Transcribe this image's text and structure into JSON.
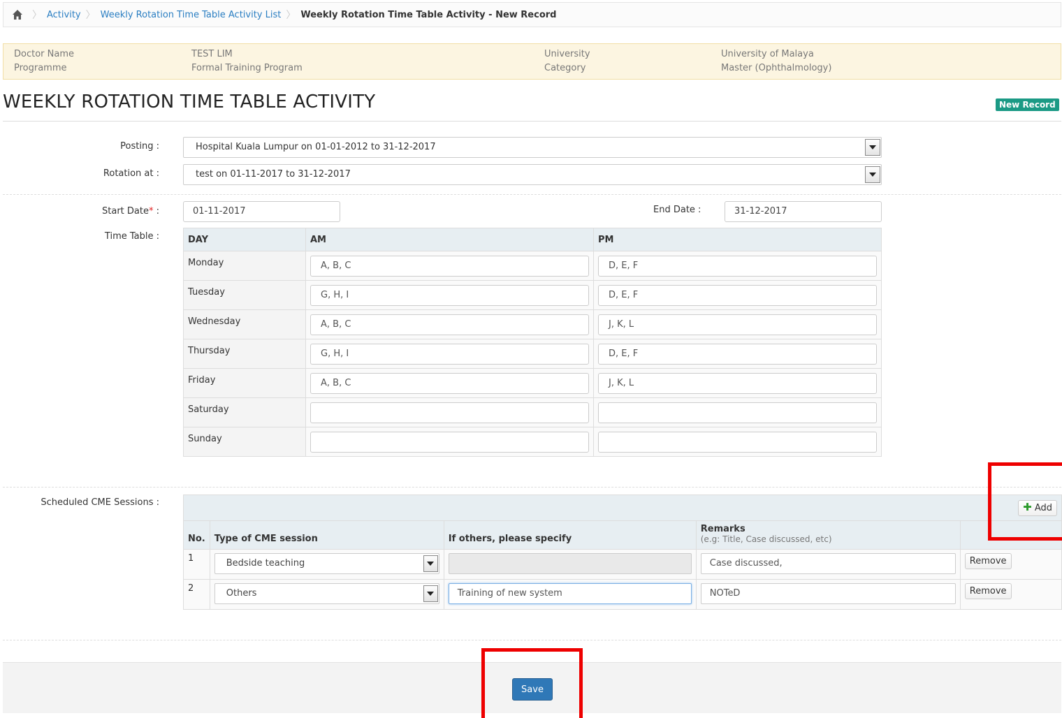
{
  "breadcrumb": {
    "items": [
      "Activity",
      "Weekly Rotation Time Table Activity List"
    ],
    "current": "Weekly Rotation Time Table Activity - New Record"
  },
  "info": {
    "doctor_name_label": "Doctor Name",
    "doctor_name": "TEST LIM",
    "programme_label": "Programme",
    "programme": "Formal Training Program",
    "university_label": "University",
    "university": "University of Malaya",
    "category_label": "Category",
    "category": "Master (Ophthalmology)"
  },
  "page": {
    "title": "WEEKLY ROTATION TIME TABLE ACTIVITY",
    "badge": "New Record"
  },
  "form": {
    "posting_label": "Posting :",
    "posting_value": "Hospital Kuala Lumpur on 01-01-2012 to 31-12-2017",
    "rotation_label": "Rotation at :",
    "rotation_value": "test on 01-11-2017 to 31-12-2017",
    "start_date_label": "Start Date",
    "start_date_required": "*",
    "start_date_colon": " :",
    "start_date": "01-11-2017",
    "end_date_label": "End Date :",
    "end_date": "31-12-2017",
    "timetable_label": "Time Table :"
  },
  "timetable": {
    "headers": [
      "DAY",
      "AM",
      "PM"
    ],
    "rows": [
      {
        "day": "Monday",
        "am": "A, B, C",
        "pm": "D, E, F"
      },
      {
        "day": "Tuesday",
        "am": "G, H, I",
        "pm": "D, E, F"
      },
      {
        "day": "Wednesday",
        "am": "A, B, C",
        "pm": "J, K, L"
      },
      {
        "day": "Thursday",
        "am": "G, H, I",
        "pm": "D, E, F"
      },
      {
        "day": "Friday",
        "am": "A, B, C",
        "pm": "J, K, L"
      },
      {
        "day": "Saturday",
        "am": "",
        "pm": ""
      },
      {
        "day": "Sunday",
        "am": "",
        "pm": ""
      }
    ]
  },
  "cme": {
    "label": "Scheduled CME Sessions :",
    "add_label": "Add",
    "headers": {
      "no": "No.",
      "type": "Type of CME session",
      "others": "If others, please specify",
      "remarks": "Remarks",
      "remarks_hint": "(e.g: Title, Case discussed, etc)"
    },
    "rows": [
      {
        "no": "1",
        "type": "Bedside teaching",
        "others": "",
        "remarks": "Case discussed,",
        "remove": "Remove"
      },
      {
        "no": "2",
        "type": "Others",
        "others": "Training of new system",
        "remarks": "NOTeD",
        "remove": "Remove"
      }
    ]
  },
  "footer": {
    "save_label": "Save"
  },
  "colors": {
    "link": "#2a7ec2",
    "badge": "#1b9a85",
    "save": "#2f78b7",
    "highlight": "#ee0000"
  }
}
